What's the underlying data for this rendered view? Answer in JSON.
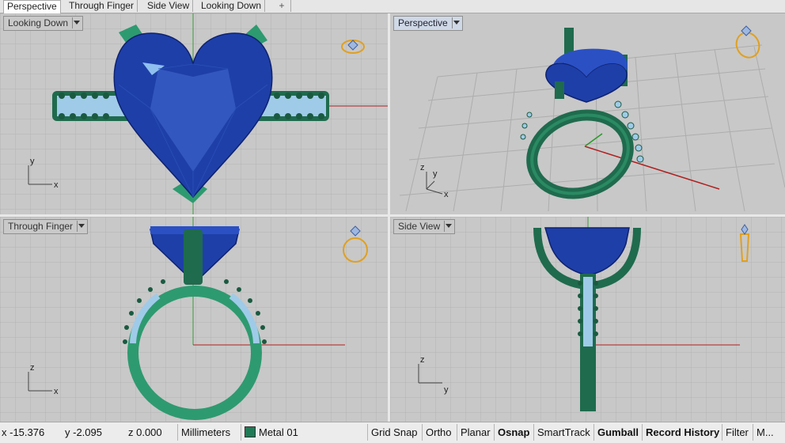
{
  "tabs": [
    {
      "label": "Perspective",
      "active": true
    },
    {
      "label": "Through Finger",
      "active": false
    },
    {
      "label": "Side View",
      "active": false
    },
    {
      "label": "Looking Down",
      "active": false
    }
  ],
  "tab_add_glyph": "+",
  "viewports": {
    "looking_down": {
      "label": "Looking Down",
      "axis_x": "x",
      "axis_y": "y"
    },
    "perspective": {
      "label": "Perspective",
      "axis_x": "x",
      "axis_y": "y",
      "axis_z": "z"
    },
    "through_finger": {
      "label": "Through Finger",
      "axis_x": "x",
      "axis_y": "z"
    },
    "side_view": {
      "label": "Side View",
      "axis_x": "y",
      "axis_y": "z"
    }
  },
  "status": {
    "x": "x -15.376",
    "y": "y -2.095",
    "z": "z 0.000",
    "units": "Millimeters",
    "layer": "Metal 01",
    "layer_color": "#1f7a56",
    "panes": [
      {
        "label": "Grid Snap",
        "bold": false
      },
      {
        "label": "Ortho",
        "bold": false
      },
      {
        "label": "Planar",
        "bold": false
      },
      {
        "label": "Osnap",
        "bold": true
      },
      {
        "label": "SmartTrack",
        "bold": false
      },
      {
        "label": "Gumball",
        "bold": true
      },
      {
        "label": "Record History",
        "bold": true
      },
      {
        "label": "Filter",
        "bold": false
      },
      {
        "label": "M...",
        "bold": false
      }
    ]
  },
  "colors": {
    "gem": "#1e3fa8",
    "metal": "#1f7a56",
    "pave": "#9fcbe8",
    "grid_bg": "#c8c8c8",
    "grid_line": "#b0b0b0",
    "x_axis": "#b02020",
    "y_axis": "#209020"
  }
}
